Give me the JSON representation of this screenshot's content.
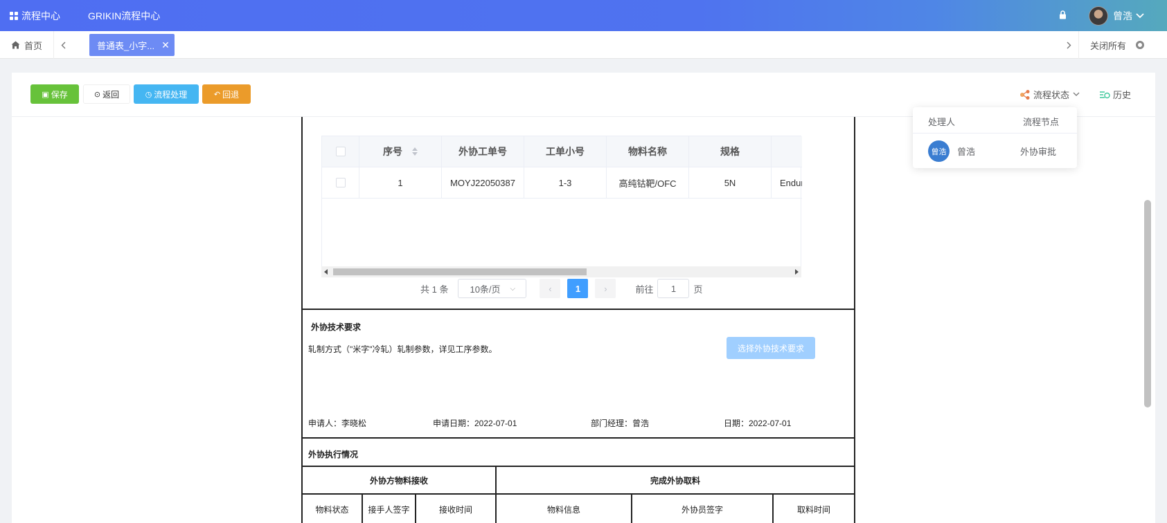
{
  "topbar": {
    "brand": "流程中心",
    "system_name": "GRIKIN流程中心",
    "user_name": "曾浩"
  },
  "tabs": {
    "home": "首页",
    "active_tab": "普通表_小字...",
    "close_all": "关闭所有"
  },
  "toolbar": {
    "save": "保存",
    "back": "返回",
    "process": "流程处理",
    "reject": "回退",
    "flow_status": "流程状态",
    "history": "历史"
  },
  "grid": {
    "columns": [
      "序号",
      "外协工单号",
      "工单小号",
      "物料名称",
      "规格"
    ],
    "rows": [
      {
        "index": "1",
        "order_no": "MOYJ22050387",
        "sub_no": "1-3",
        "material": "高纯钴靶/OFC",
        "spec": "5N",
        "extra": "Endur"
      }
    ]
  },
  "pager": {
    "total": "共 1 条",
    "page_size": "10条/页",
    "current_page": "1",
    "goto_label": "前往",
    "goto_value": "1",
    "page_unit": "页"
  },
  "tech": {
    "title": "外协技术要求",
    "desc": "轧制方式（\"米字\"冷轧）轧制参数，详见工序参数。",
    "select_button": "选择外协技术要求",
    "applicant": "申请人：李晓松",
    "apply_date": "申请日期：2022-07-01",
    "manager": "部门经理：曾浩",
    "date": "日期：2022-07-01"
  },
  "exec": {
    "title": "外协执行情况",
    "group_receive": "外协方物料接收",
    "group_pickup": "完成外协取料",
    "cols": [
      "物料状态",
      "接手人签字",
      "接收时间",
      "物料信息",
      "外协员签字",
      "取料时间"
    ]
  },
  "popover": {
    "col_handler": "处理人",
    "col_node": "流程节点",
    "avatar_text": "曾浩",
    "handler": "曾浩",
    "node": "外协审批"
  },
  "colors": {
    "topbar_start": "#4f6ef2",
    "topbar_end": "#55a9bd",
    "save": "#67c23a",
    "process": "#45b6f2",
    "reject": "#eb9b2a",
    "primary": "#409eff"
  }
}
